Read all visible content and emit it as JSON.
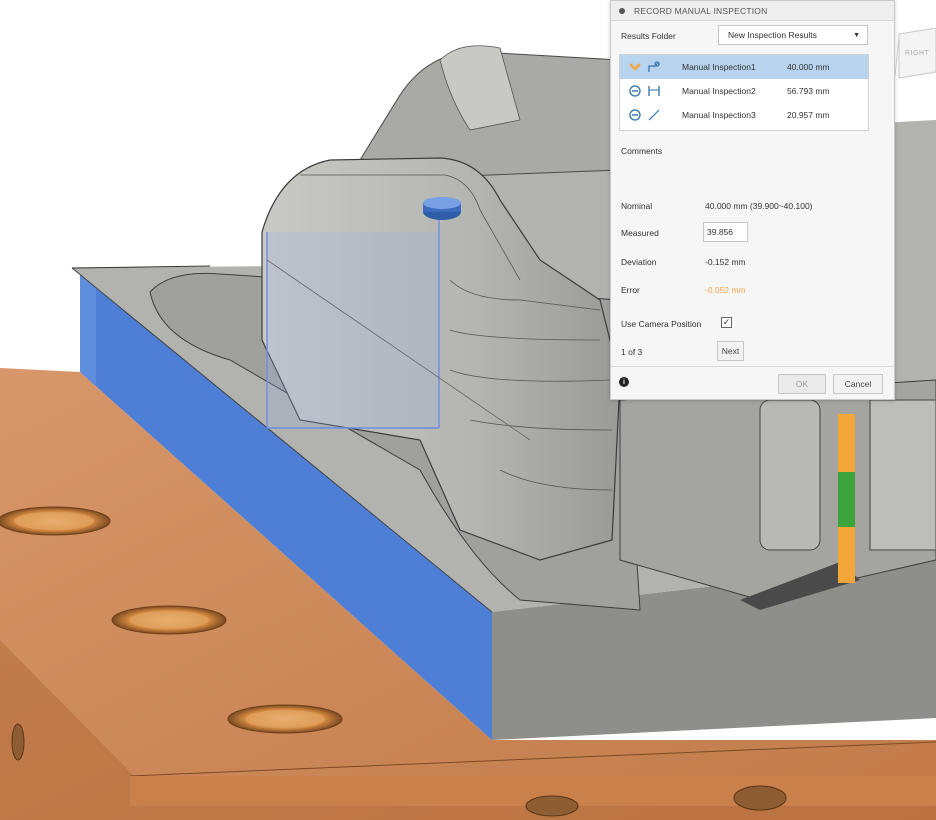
{
  "dialog": {
    "title": "RECORD MANUAL INSPECTION",
    "results_folder_label": "Results Folder",
    "results_folder_value": "New Inspection Results",
    "inspections": [
      {
        "name": "Manual Inspection1",
        "value": "40.000 mm",
        "status_icon": "chevron-down-icon",
        "type_icon": "point-distance-icon",
        "selected": true
      },
      {
        "name": "Manual Inspection2",
        "value": "56.793 mm",
        "status_icon": "minus-circle-icon",
        "type_icon": "caliper-icon",
        "selected": false
      },
      {
        "name": "Manual Inspection3",
        "value": "20.957 mm",
        "status_icon": "minus-circle-icon",
        "type_icon": "diagonal-line-icon",
        "selected": false
      }
    ],
    "comments_label": "Comments",
    "nominal_label": "Nominal",
    "nominal_value": "40.000 mm (39.900~40.100)",
    "measured_label": "Measured",
    "measured_value": "39.856",
    "deviation_label": "Deviation",
    "deviation_value": "-0.152 mm",
    "error_label": "Error",
    "error_value": "-0.052 mm",
    "camera_label": "Use Camera Position",
    "camera_checked": true,
    "counter": "1 of 3",
    "next_label": "Next",
    "ok_label": "OK",
    "cancel_label": "Cancel"
  },
  "viewcube": {
    "label": "RIGHT"
  },
  "colors": {
    "selected_row": "#b7d3ee",
    "error_text": "#f5a24a",
    "icon_blue": "#2f6fb0",
    "status_orange": "#f5a442",
    "part_gray": "#a8a8a4",
    "side_blue": "#4e7fd6",
    "fixture_copper": "#cf8956",
    "gauge_orange": "#f2a63a",
    "gauge_green": "#3ca43c"
  }
}
